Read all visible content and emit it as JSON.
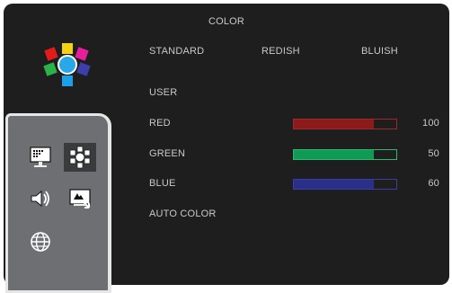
{
  "menu": {
    "title": "COLOR",
    "modes": [
      "STANDARD",
      "REDISH",
      "BLUISH"
    ],
    "user_label": "USER",
    "channels": [
      {
        "label": "RED",
        "value": "100",
        "level": 0.78,
        "color": "#8b1a1a",
        "border": "#a02a2a"
      },
      {
        "label": "GREEN",
        "value": "50",
        "level": 0.78,
        "color": "#0f9a55",
        "border": "#2fb86c"
      },
      {
        "label": "BLUE",
        "value": "60",
        "level": 0.78,
        "color": "#2b2f8a",
        "border": "#3a3f9f"
      }
    ],
    "auto_color_label": "AUTO COLOR"
  },
  "sidebar": {
    "items": [
      {
        "icon": "picture-icon",
        "selected": false
      },
      {
        "icon": "color-icon",
        "selected": true
      },
      {
        "icon": "audio-icon",
        "selected": false
      },
      {
        "icon": "image-setup-icon",
        "selected": false
      },
      {
        "icon": "globe-icon",
        "selected": false
      }
    ]
  },
  "logo": {
    "petal_colors": [
      "#e31b1b",
      "#e61e9a",
      "#3c3faa",
      "#1aa1e8",
      "#2bb34a",
      "#f5d312"
    ],
    "center_color": "#2aa7e6"
  }
}
